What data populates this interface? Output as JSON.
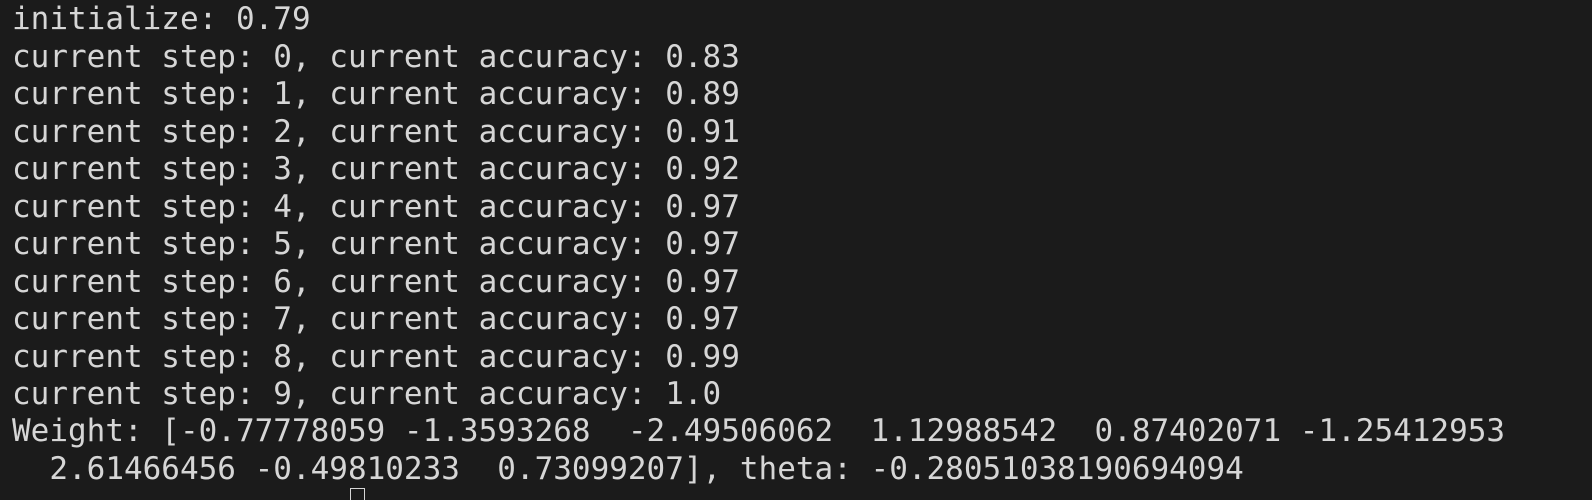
{
  "terminal": {
    "lines": [
      "initialize: 0.79",
      "current step: 0, current accuracy: 0.83",
      "current step: 1, current accuracy: 0.89",
      "current step: 2, current accuracy: 0.91",
      "current step: 3, current accuracy: 0.92",
      "current step: 4, current accuracy: 0.97",
      "current step: 5, current accuracy: 0.97",
      "current step: 6, current accuracy: 0.97",
      "current step: 7, current accuracy: 0.97",
      "current step: 8, current accuracy: 0.99",
      "current step: 9, current accuracy: 1.0",
      "Weight: [-0.77778059 -1.3593268  -2.49506062  1.12988542  0.87402071 -1.25412953",
      "  2.61466456 -0.49810233  0.73099207], theta: -0.28051038190694094"
    ],
    "colors": {
      "background": "#1b1b1b",
      "text": "#d6d6d6"
    }
  }
}
